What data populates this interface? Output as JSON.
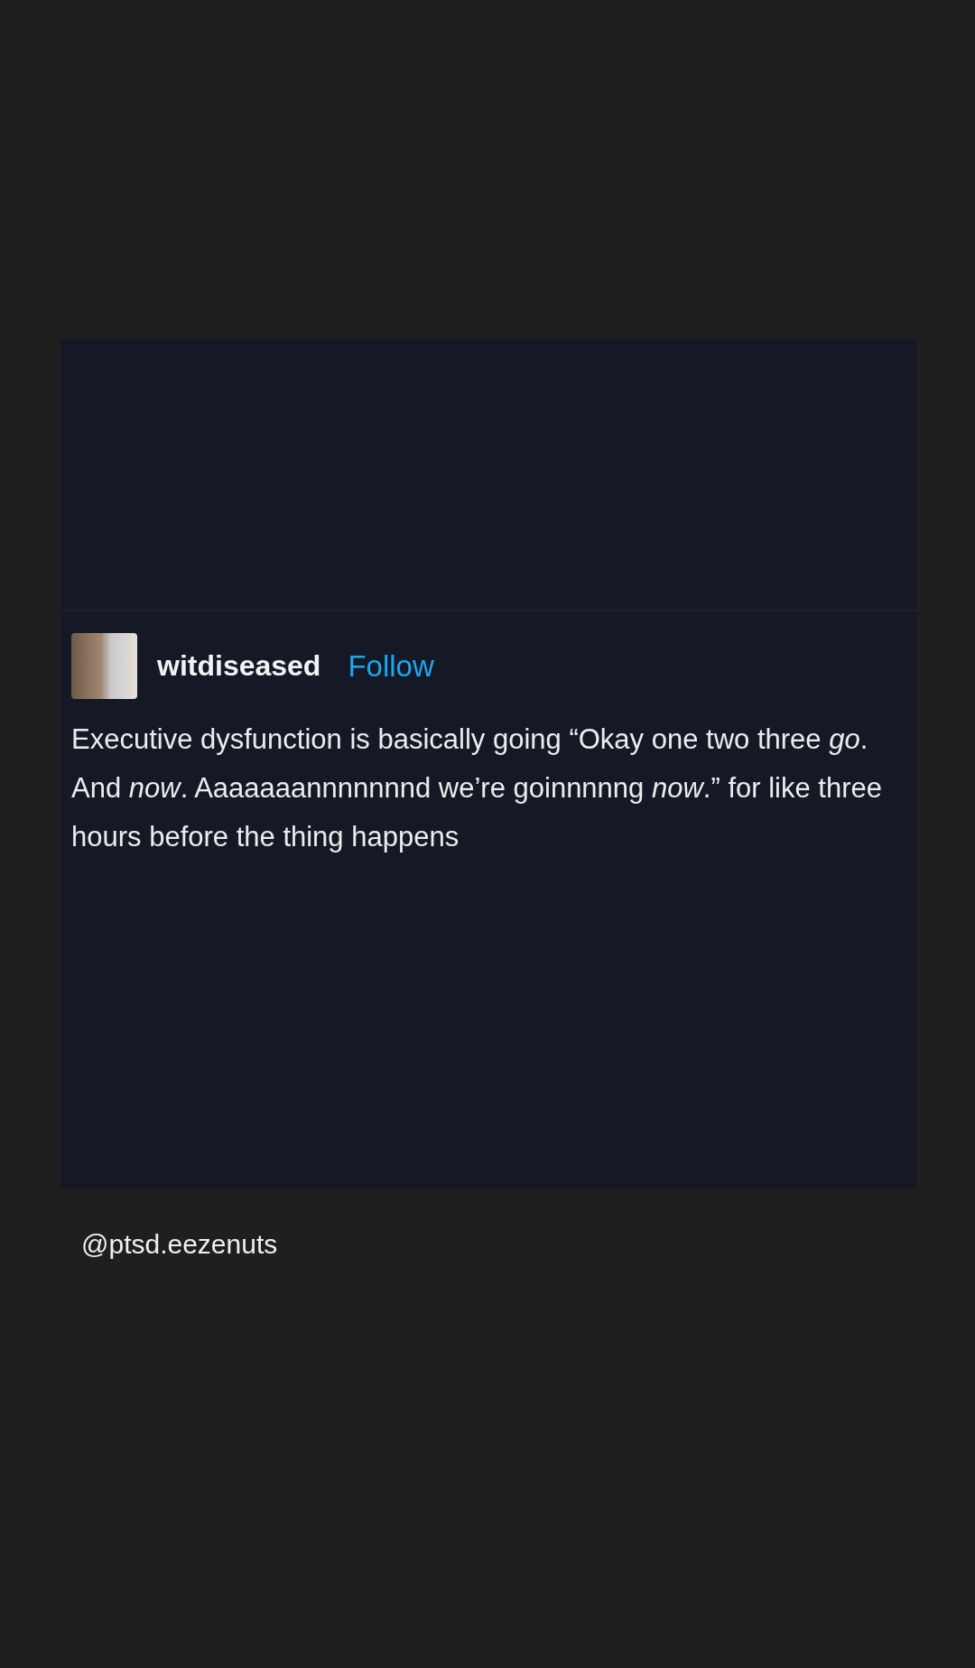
{
  "post": {
    "username": "witdiseased",
    "follow": "Follow",
    "text": "Executive dysfunction is basically going “Okay one two three *go*. And *now*. Aaaaaaannnnnnnd we’re goinnnnng *now*.” for like three hours before the thing happens"
  },
  "caption": "@ptsd.eezenuts"
}
